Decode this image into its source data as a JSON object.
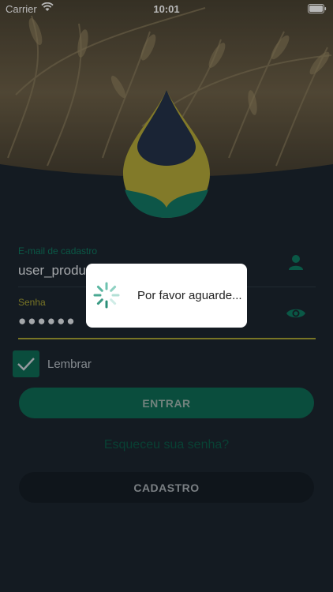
{
  "status_bar": {
    "carrier": "Carrier",
    "time": "10:01"
  },
  "form": {
    "email_label": "E-mail de cadastro",
    "email_value": "user_produ",
    "password_label": "Senha",
    "password_value": "●●●●●●",
    "remember_label": "Lembrar",
    "remember_checked": true
  },
  "actions": {
    "login_label": "ENTRAR",
    "forgot_label": "Esqueceu sua senha?",
    "register_label": "CADASTRO"
  },
  "loading": {
    "message": "Por favor aguarde..."
  },
  "colors": {
    "background": "#1d2630",
    "accent_green": "#0f6b55",
    "accent_olive": "#a7a234",
    "logo_navy": "#25324a",
    "logo_gold": "#b4a93a",
    "logo_green": "#137864"
  },
  "icons": [
    "wifi-icon",
    "battery-icon",
    "user-icon",
    "eye-icon",
    "checkmark-icon",
    "spinner-icon"
  ]
}
